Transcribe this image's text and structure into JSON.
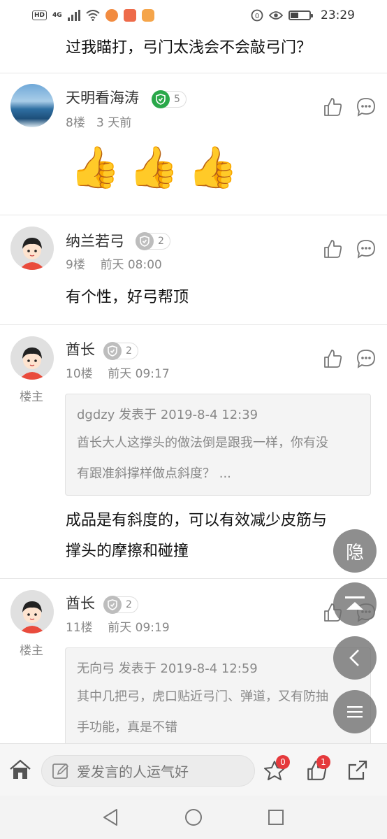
{
  "statusbar": {
    "left_badges": [
      "HD",
      "4G"
    ],
    "time": "23:29"
  },
  "top_text": "过我瞄打，弓门太浅会不会敲弓门？",
  "posts": [
    {
      "name": "天明看海涛",
      "level": "5",
      "floor": "8楼",
      "time": "3 天前",
      "content_emoji": [
        "👍",
        "👍",
        "👍"
      ]
    },
    {
      "name": "纳兰若弓",
      "level": "2",
      "floor": "9楼",
      "time": "前天 08:00",
      "content": "有个性，好弓帮顶"
    },
    {
      "name": "酋长",
      "level": "2",
      "floor": "10楼",
      "time": "前天 09:17",
      "tag": "楼主",
      "quote_head": "dgdzy 发表于 2019-8-4 12:39",
      "quote_lines": [
        "酋长大人这撑头的做法倒是跟我一样，你有没",
        "有跟准斜撑样做点斜度？ ..."
      ],
      "content_lines": [
        "成品是有斜度的，可以有效减少皮筋与",
        "撑头的摩擦和碰撞"
      ]
    },
    {
      "name": "酋长",
      "level": "2",
      "floor": "11楼",
      "time": "前天 09:19",
      "tag": "楼主",
      "quote_head": "无向弓 发表于 2019-8-4 12:59",
      "quote_lines": [
        "其中几把弓，虎口贴近弓门、弹道，又有防抽",
        "手功能，真是不错"
      ]
    }
  ],
  "fabs": {
    "hide_label": "隐"
  },
  "bottombar": {
    "input_placeholder": "爱发言的人运气好",
    "star_count": "0",
    "like_count": "1"
  },
  "colors": {
    "badge_red": "#e5393c",
    "level_green": "#2aa84a"
  }
}
